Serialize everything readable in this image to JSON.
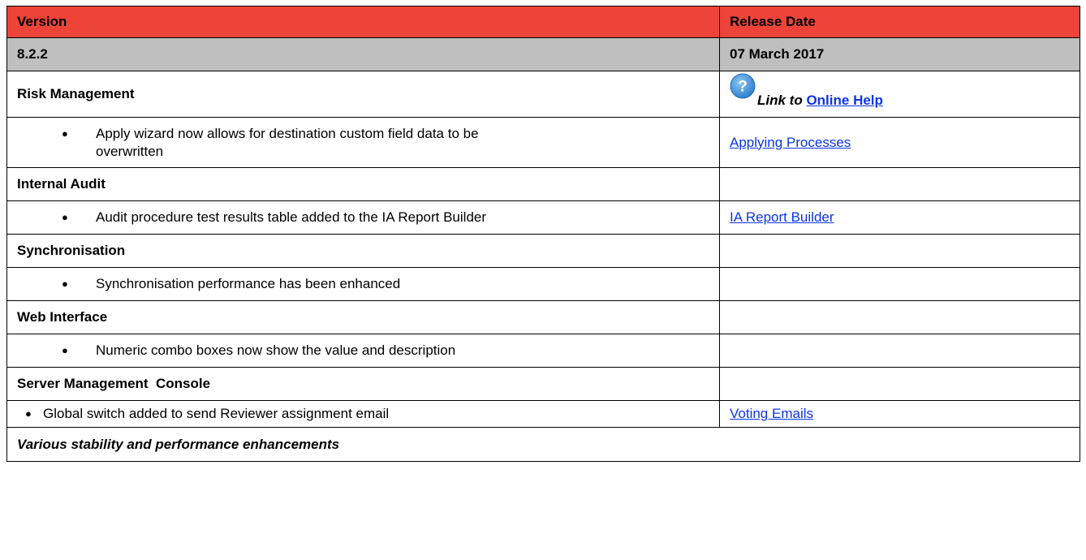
{
  "header": {
    "version_label": "Version",
    "date_label": "Release Date"
  },
  "release": {
    "version": "8.2.2",
    "date": "07 March 2017"
  },
  "help": {
    "prefix": "Link to",
    "link": "Online Help",
    "icon": "help-question-icon"
  },
  "sections": {
    "risk": {
      "title": "Risk Management",
      "item_line1": "Apply wizard now allows for destination custom field data to be",
      "item_line2": "overwritten",
      "link": "Applying Processes"
    },
    "audit": {
      "title": "Internal Audit",
      "item": "Audit procedure test results table added to the IA Report Builder",
      "link": "IA Report Builder"
    },
    "sync": {
      "title": "Synchronisation",
      "item": "Synchronisation performance has been enhanced"
    },
    "web": {
      "title": "Web Interface",
      "item": "Numeric combo boxes now show the value and description"
    },
    "server": {
      "title": "Server Management  Console",
      "item": "Global switch added to send Reviewer assignment email",
      "link": "Voting Emails"
    }
  },
  "footer": {
    "text": "Various stability and performance enhancements"
  },
  "colors": {
    "header_bg": "#ee4339",
    "version_bg": "#bfbfbf",
    "link": "#0b35e8",
    "help_icon": "#3b8fd9"
  }
}
